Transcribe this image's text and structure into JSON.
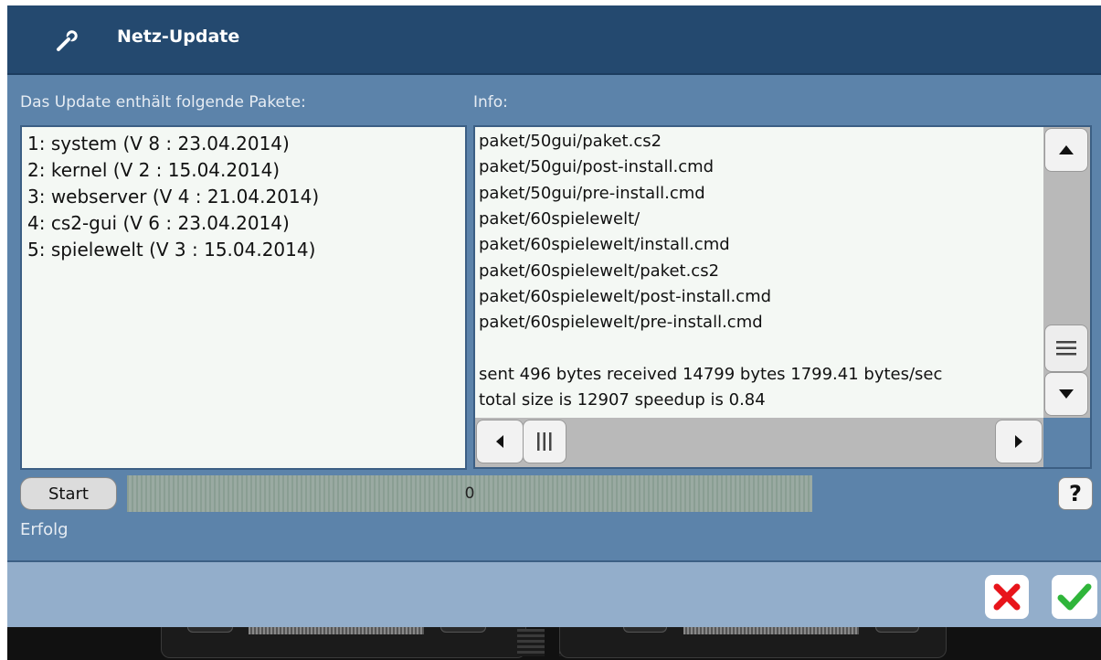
{
  "window": {
    "title": "Netz-Update",
    "icon": "wrench-icon"
  },
  "packages": {
    "label": "Das Update enthält folgende Pakete:",
    "items": [
      "1: system (V 8 : 23.04.2014)",
      "2: kernel (V 2 : 15.04.2014)",
      "3: webserver (V 4 : 21.04.2014)",
      "4: cs2-gui (V 6 : 23.04.2014)",
      "5: spielewelt (V 3 : 15.04.2014)"
    ]
  },
  "info": {
    "label": "Info:",
    "lines": [
      "paket/50gui/paket.cs2",
      "paket/50gui/post-install.cmd",
      "paket/50gui/pre-install.cmd",
      "paket/60spielewelt/",
      "paket/60spielewelt/install.cmd",
      "paket/60spielewelt/paket.cs2",
      "paket/60spielewelt/post-install.cmd",
      "paket/60spielewelt/pre-install.cmd",
      "",
      "sent 496 bytes  received 14799 bytes  1799.41 bytes/sec",
      "total size is 12907  speedup is 0.84"
    ]
  },
  "controls": {
    "start_label": "Start",
    "progress_value": "0",
    "help_label": "?"
  },
  "status": {
    "text": "Erfolg"
  },
  "colors": {
    "titlebar": "#24496f",
    "dialog": "#5c83aa",
    "footer": "#93aecb",
    "cancel": "#e8151b",
    "ok": "#2fb53a"
  }
}
